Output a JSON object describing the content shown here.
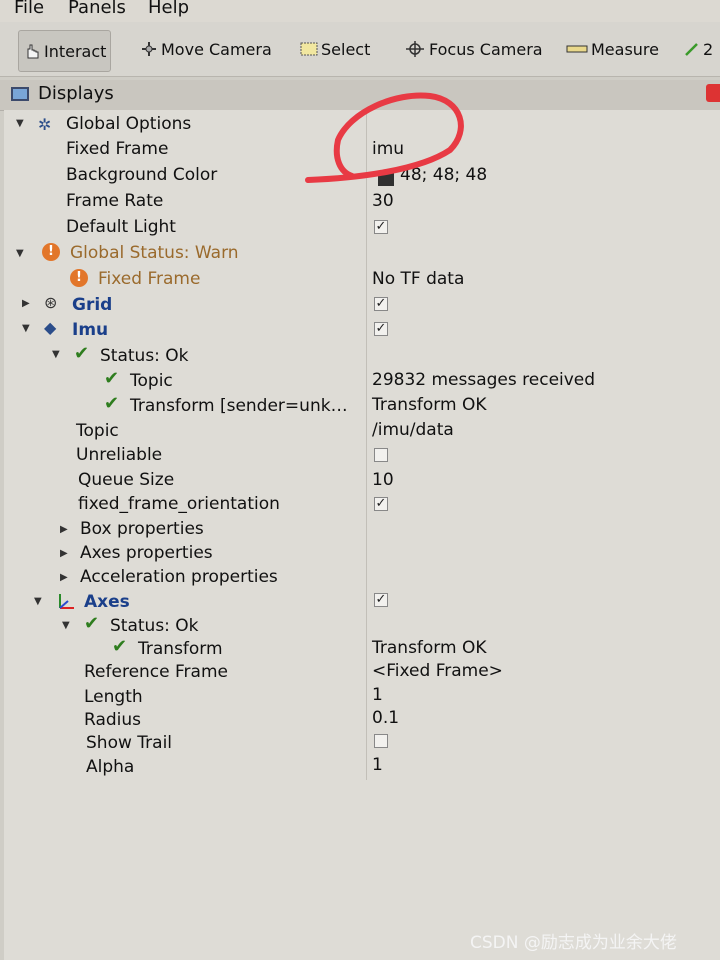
{
  "menu": [
    "File",
    "Panels",
    "Help"
  ],
  "toolbar": {
    "interact": "Interact",
    "move_camera": "Move Camera",
    "select": "Select",
    "focus_camera": "Focus Camera",
    "measure": "Measure",
    "extra": "2"
  },
  "panel": {
    "title": "Displays"
  },
  "tree": {
    "global_options": "Global Options",
    "fixed_frame": {
      "label": "Fixed Frame",
      "value": "imu"
    },
    "background_color": {
      "label": "Background Color",
      "value": "48; 48; 48"
    },
    "frame_rate": {
      "label": "Frame Rate",
      "value": "30"
    },
    "default_light": {
      "label": "Default Light",
      "value": "✓"
    },
    "global_status": "Global Status: Warn",
    "fixed_frame_status": {
      "label": "Fixed Frame",
      "value": "No TF data"
    },
    "grid": {
      "label": "Grid",
      "value": "✓"
    },
    "imu": {
      "label": "Imu",
      "value": "✓"
    },
    "imu_status": "Status: Ok",
    "imu_topic_status": {
      "label": "Topic",
      "value": "29832 messages received"
    },
    "imu_transform_status": {
      "label": "Transform [sender=unk…",
      "value": "Transform OK"
    },
    "imu_topic": {
      "label": "Topic",
      "value": "/imu/data"
    },
    "imu_unreliable": {
      "label": "Unreliable",
      "value": ""
    },
    "imu_queue": {
      "label": "Queue Size",
      "value": "10"
    },
    "imu_ffo": {
      "label": "fixed_frame_orientation",
      "value": "✓"
    },
    "box_props": "Box properties",
    "axes_props": "Axes properties",
    "accel_props": "Acceleration properties",
    "axes": {
      "label": "Axes",
      "value": "✓"
    },
    "axes_status": "Status: Ok",
    "axes_transform": {
      "label": "Transform",
      "value": "Transform OK"
    },
    "axes_ref": {
      "label": "Reference Frame",
      "value": "<Fixed Frame>"
    },
    "axes_length": {
      "label": "Length",
      "value": "1"
    },
    "axes_radius": {
      "label": "Radius",
      "value": "0.1"
    },
    "axes_trail": {
      "label": "Show Trail",
      "value": ""
    },
    "axes_alpha": {
      "label": "Alpha",
      "value": "1"
    }
  },
  "watermark": "CSDN @励志成为业余大佬",
  "colors": {
    "warn": "#e2762a",
    "ok": "#2e7d1e",
    "annotation": "#e83a44"
  }
}
